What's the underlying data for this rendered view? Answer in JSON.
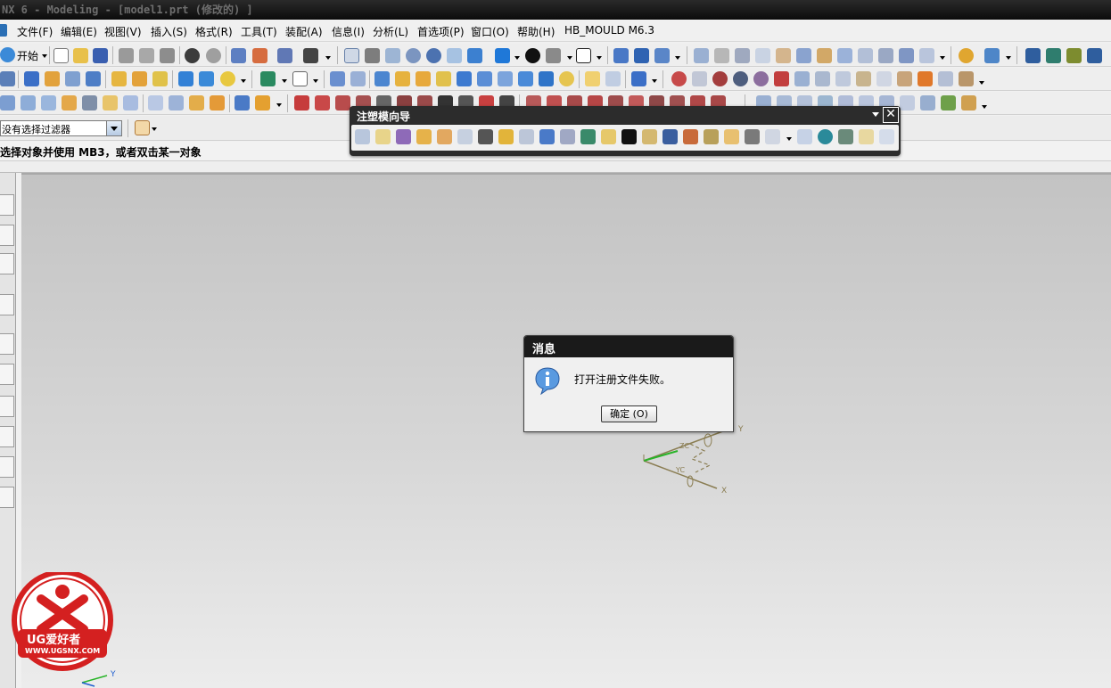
{
  "window": {
    "title": "NX 6 - Modeling - [model1.prt  (修改的) ]"
  },
  "menu": {
    "start_label": "开始",
    "items": [
      "文件(F)",
      "编辑(E)",
      "视图(V)",
      "插入(S)",
      "格式(R)",
      "工具(T)",
      "装配(A)",
      "信息(I)",
      "分析(L)",
      "首选项(P)",
      "窗口(O)",
      "帮助(H)",
      "HB_MOULD M6.3"
    ]
  },
  "selection": {
    "filter_value": "没有选择过滤器"
  },
  "status": {
    "prompt": "选择对象并使用 MB3，或者双击某一对象"
  },
  "mold_wizard": {
    "title": "注塑模向导",
    "close_symbol": "✕"
  },
  "dialog": {
    "title": "消息",
    "message": "打开注册文件失败。",
    "ok_label": "确定 (O)"
  },
  "axes": {
    "x": "X",
    "y": "Y",
    "xc": "XC",
    "yc": "YC",
    "zc": "ZC"
  },
  "watermark": {
    "title": "UG爱好者",
    "site": "WWW.UGSNX.COM"
  },
  "colors": {
    "title_bar": "#1a1a1a",
    "graphics_top": "#c3c3c3",
    "graphics_bottom": "#ececec",
    "wcs_line": "#8a7d52",
    "accent_green": "#28b428"
  }
}
